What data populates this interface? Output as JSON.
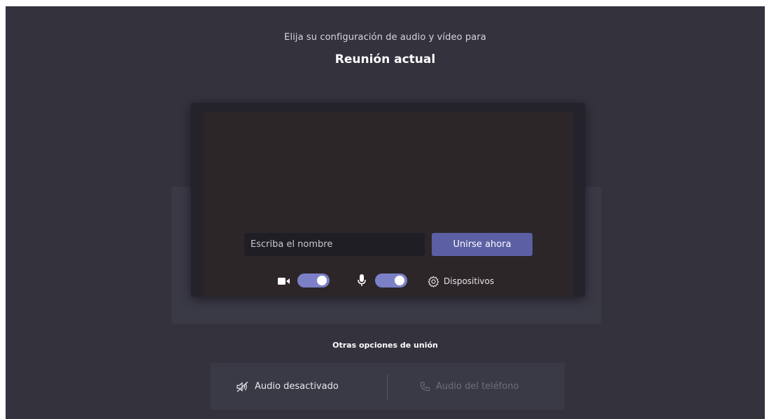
{
  "header": {
    "subtitle": "Elija su configuración de audio y vídeo para",
    "meeting_title": "Reunión actual"
  },
  "join": {
    "name_placeholder": "Escriba el nombre",
    "name_value": "",
    "join_button_label": "Unirse ahora"
  },
  "controls": {
    "camera": {
      "icon": "video-camera-icon",
      "toggle_state": "on"
    },
    "microphone": {
      "icon": "microphone-icon",
      "toggle_state": "on"
    },
    "devices_label": "Dispositivos",
    "devices_icon": "gear-icon"
  },
  "other_options": {
    "label": "Otras opciones de unión",
    "audio_off_label": "Audio desactivado",
    "audio_off_icon": "speaker-muted-icon",
    "phone_audio_label": "Audio del teléfono",
    "phone_audio_icon": "phone-icon"
  },
  "colors": {
    "background": "#33323d",
    "accent": "#5b5fa4",
    "toggle_on": "#7b80c7",
    "disabled_text": "#6f6e7a"
  }
}
